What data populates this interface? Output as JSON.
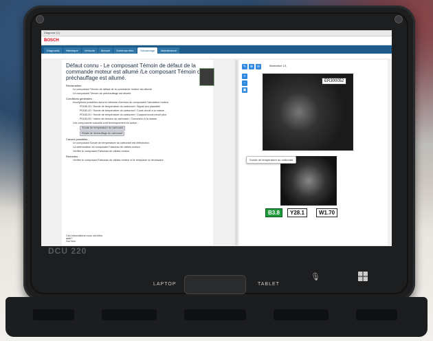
{
  "device": {
    "brand": "DCU 220",
    "laptop_label": "LAPTOP",
    "tablet_label": "TABLET"
  },
  "window": {
    "title": "Diagnose (1)"
  },
  "app": {
    "logo": "BOSCH"
  },
  "nav": {
    "tabs": [
      "Diagnostic",
      "Historique",
      "Véhicule",
      "Manuel",
      "Schémas élec.",
      "Dépannage",
      "Maintenance"
    ]
  },
  "document": {
    "title": "Défaut connu - Le composant Témoin de défaut de la commande moteur est allumé /Le composant Témoin de préchauffage est allumé.",
    "sections": [
      {
        "heading": "Réclamation :",
        "lines": [
          "Le composant Témoin de défaut de la commande moteur est allumé.",
          "Le composant Témoin de préchauffage est allumé."
        ]
      },
      {
        "heading": "Conditions générales :",
        "lines": [
          "Inscriptions possibles dans la mémoire d'erreurs du composant Calculateur moteur",
          "P0180-00 / Sonde de température du carburant / Signal peu plausible",
          "P0182-00 / Sonde de température du carburant / Court-circuit à la masse",
          "P0183-00 / Sonde de température du carburant / Coupure/court-circuit plus",
          "P0183-00 / Valeur de tension du carburant / Connexion à la masse",
          "Les composants suivants sont techniquement en action :",
          "Sonde de température du carburant",
          "Relais de réchauffage du carburant"
        ]
      },
      {
        "heading": "Causes possibles :",
        "lines": [
          "Le composant Sonde de température du carburant est défectueux.",
          "La détérioration du composant Faisceau de câbles moteur",
          "Vérifier le composant Faisceau de câbles moteur"
        ]
      },
      {
        "heading": "Remèdes :",
        "lines": [
          "Vérifier le composant Faisceau de câbles moteur et le remplacer si nécessaire."
        ]
      }
    ],
    "feedback_question": "Ces informations vous ont-elles aidé?",
    "feedback_yes": "Oui",
    "feedback_no": "Non"
  },
  "viewer": {
    "title": "Illustration 1/1",
    "engine_id": "ER300052",
    "tooltip": "Sonde de température du carburant",
    "labels": [
      "B3.8",
      "Y28.1",
      "W1.70"
    ]
  },
  "colors": {
    "nav": "#1d5c8a",
    "accent": "#2f8ae0",
    "brand": "#e20015",
    "highlight": "#1f9a3a"
  }
}
